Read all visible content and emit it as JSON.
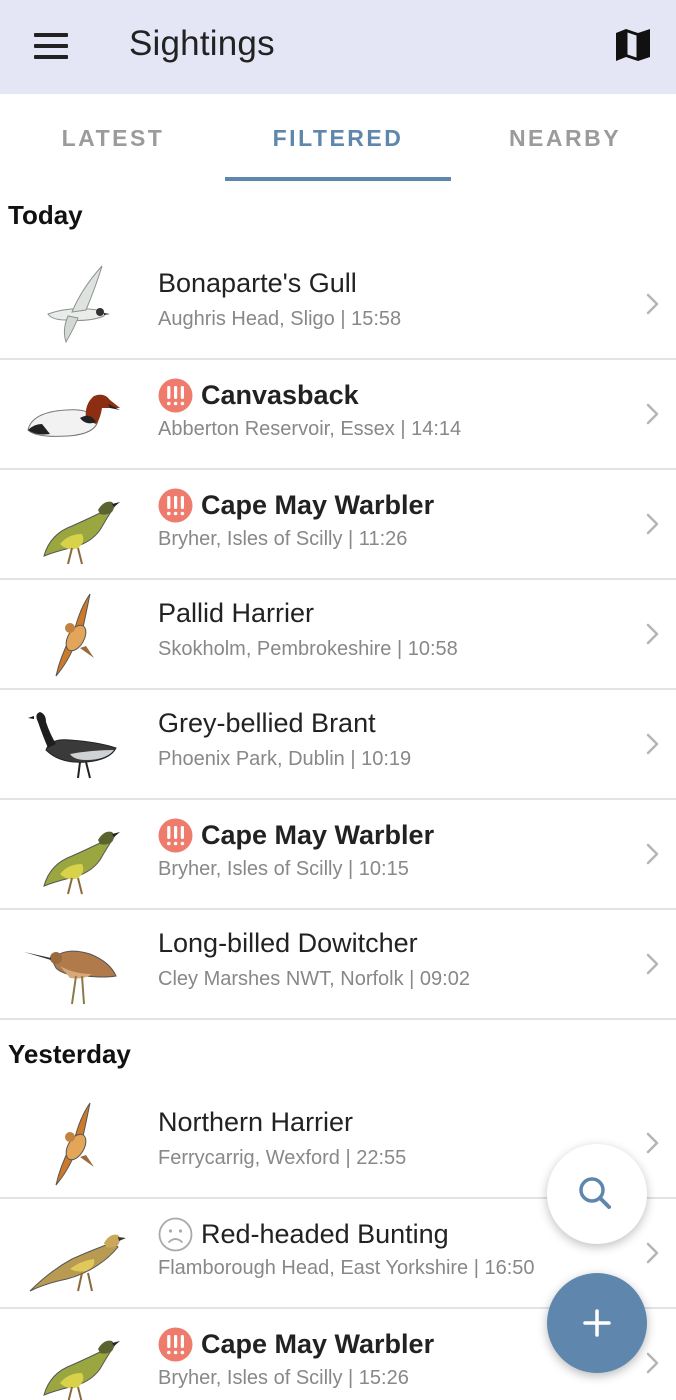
{
  "app_bar": {
    "title": "Sightings",
    "menu_icon": "hamburger-menu-icon",
    "map_icon": "map-icon",
    "background": "#e4e6f6"
  },
  "tabs": [
    {
      "label": "LATEST",
      "active": false
    },
    {
      "label": "FILTERED",
      "active": true
    },
    {
      "label": "NEARBY",
      "active": false
    }
  ],
  "accent_color": "#5f87ad",
  "rarity_badge_color": "#ee7b6b",
  "sections": [
    {
      "header": "Today",
      "items": [
        {
          "species": "Bonaparte's Gull",
          "location": "Aughris Head, Sligo",
          "time": "15:58",
          "details": "Aughris Head, Sligo | 15:58",
          "status": "none",
          "bird_icon": "gull-illustration"
        },
        {
          "species": "Canvasback",
          "location": "Abberton Reservoir, Essex",
          "time": "14:14",
          "details": "Abberton Reservoir, Essex | 14:14",
          "status": "mega-rarity",
          "bird_icon": "duck-illustration"
        },
        {
          "species": "Cape May Warbler",
          "location": "Bryher, Isles of Scilly",
          "time": "11:26",
          "details": "Bryher, Isles of Scilly | 11:26",
          "status": "mega-rarity",
          "bird_icon": "warbler-illustration"
        },
        {
          "species": "Pallid Harrier",
          "location": "Skokholm, Pembrokeshire",
          "time": "10:58",
          "details": "Skokholm, Pembrokeshire | 10:58",
          "status": "none",
          "bird_icon": "harrier-flight-illustration"
        },
        {
          "species": "Grey-bellied Brant",
          "location": "Phoenix Park, Dublin",
          "time": "10:19",
          "details": "Phoenix Park, Dublin | 10:19",
          "status": "none",
          "bird_icon": "goose-illustration"
        },
        {
          "species": "Cape May Warbler",
          "location": "Bryher, Isles of Scilly",
          "time": "10:15",
          "details": "Bryher, Isles of Scilly | 10:15",
          "status": "mega-rarity",
          "bird_icon": "warbler-illustration"
        },
        {
          "species": "Long-billed Dowitcher",
          "location": "Cley Marshes NWT, Norfolk",
          "time": "09:02",
          "details": "Cley Marshes NWT, Norfolk | 09:02",
          "status": "none",
          "bird_icon": "wader-illustration"
        }
      ]
    },
    {
      "header": "Yesterday",
      "items": [
        {
          "species": "Northern Harrier",
          "location": "Ferrycarrig, Wexford",
          "time": "22:55",
          "details": "Ferrycarrig, Wexford | 22:55",
          "status": "none",
          "bird_icon": "harrier-flight-illustration"
        },
        {
          "species": "Red-headed Bunting",
          "location": "Flamborough Head, East Yorkshire",
          "time": "16:50",
          "details": "Flamborough Head, East Yorkshire | 16:50",
          "status": "dubious",
          "bird_icon": "bunting-illustration"
        },
        {
          "species": "Cape May Warbler",
          "location": "Bryher, Isles of Scilly",
          "time": "15:26",
          "details": "Bryher, Isles of Scilly | 15:26",
          "status": "mega-rarity",
          "bird_icon": "warbler-illustration"
        }
      ]
    }
  ],
  "fabs": {
    "search_icon": "search-icon",
    "add_icon": "plus-icon"
  }
}
